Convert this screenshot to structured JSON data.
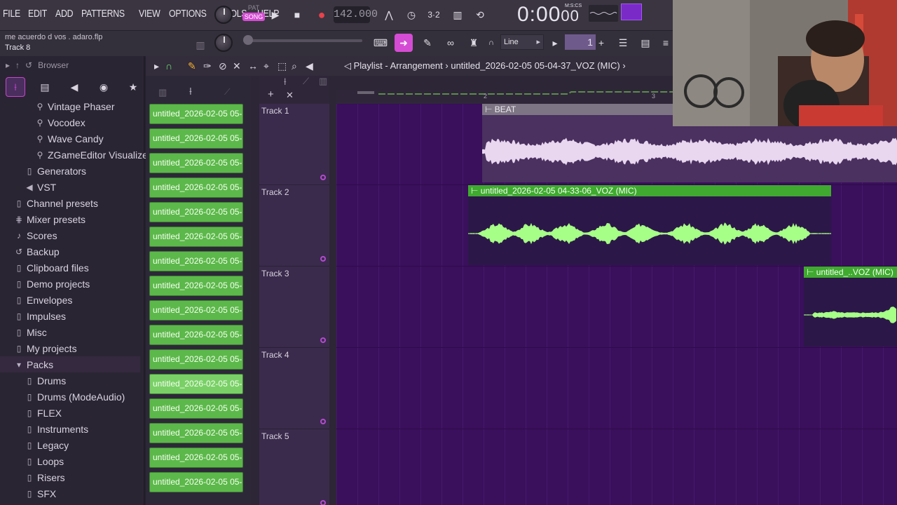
{
  "menu": [
    "FILE",
    "EDIT",
    "ADD",
    "PATTERNS",
    "VIEW",
    "OPTIONS",
    "TOOLS",
    "HELP"
  ],
  "transport": {
    "pat_label": "PAT",
    "song_label": "SONG",
    "tempo": "142.000",
    "time": "0:00",
    "time_small": "00",
    "time_format": "M:S:CS"
  },
  "project": {
    "filename": "me acuerdo d vos . adaro.flp",
    "hint": "Track 8"
  },
  "snap": "Line",
  "pattern_number": "1",
  "browser": {
    "title": "Browser",
    "items": [
      {
        "label": "Vintage Phaser",
        "icon": "plugin-icon",
        "indent": 2
      },
      {
        "label": "Vocodex",
        "icon": "plugin-icon",
        "indent": 2
      },
      {
        "label": "Wave Candy",
        "icon": "plugin-icon",
        "indent": 2
      },
      {
        "label": "ZGameEditor Visualizer",
        "icon": "plugin-icon",
        "indent": 2
      },
      {
        "label": "Generators",
        "icon": "folder-icon",
        "indent": 1
      },
      {
        "label": "VST",
        "icon": "speaker-icon",
        "indent": 1
      },
      {
        "label": "Channel presets",
        "icon": "folder-icon",
        "indent": 0
      },
      {
        "label": "Mixer presets",
        "icon": "mixer-icon",
        "indent": 0
      },
      {
        "label": "Scores",
        "icon": "note-icon",
        "indent": 0
      },
      {
        "label": "Backup",
        "icon": "backup-icon",
        "indent": 0
      },
      {
        "label": "Clipboard files",
        "icon": "folder-icon",
        "indent": 0
      },
      {
        "label": "Demo projects",
        "icon": "folder-icon",
        "indent": 0
      },
      {
        "label": "Envelopes",
        "icon": "folder-icon",
        "indent": 0
      },
      {
        "label": "Impulses",
        "icon": "folder-icon",
        "indent": 0
      },
      {
        "label": "Misc",
        "icon": "folder-icon",
        "indent": 0
      },
      {
        "label": "My projects",
        "icon": "folder-icon",
        "indent": 0
      },
      {
        "label": "Packs",
        "icon": "folder-open-icon",
        "indent": 0,
        "selected": true
      },
      {
        "label": "Drums",
        "icon": "folder-icon",
        "indent": 1
      },
      {
        "label": "Drums (ModeAudio)",
        "icon": "folder-icon",
        "indent": 1
      },
      {
        "label": "FLEX",
        "icon": "folder-icon",
        "indent": 1
      },
      {
        "label": "Instruments",
        "icon": "folder-icon",
        "indent": 1
      },
      {
        "label": "Legacy",
        "icon": "folder-icon",
        "indent": 1
      },
      {
        "label": "Loops",
        "icon": "folder-icon",
        "indent": 1
      },
      {
        "label": "Risers",
        "icon": "folder-icon",
        "indent": 1
      },
      {
        "label": "SFX",
        "icon": "folder-icon",
        "indent": 1
      }
    ]
  },
  "playlist": {
    "title": "Playlist - Arrangement",
    "path": "untitled_2026-02-05 05-04-37_VOZ (MIC)",
    "clip_picker": [
      "untitled_2026-02-05 05-...",
      "untitled_2026-02-05 05-...",
      "untitled_2026-02-05 05-...",
      "untitled_2026-02-05 05-...",
      "untitled_2026-02-05 05-...",
      "untitled_2026-02-05 05-...",
      "untitled_2026-02-05 05-...",
      "untitled_2026-02-05 05-...",
      "untitled_2026-02-05 05-...",
      "untitled_2026-02-05 05-...",
      "untitled_2026-02-05 05-...",
      "untitled_2026-02-05 05-...",
      "untitled_2026-02-05 05-...",
      "untitled_2026-02-05 05-...",
      "untitled_2026-02-05 05-...",
      "untitled_2026-02-05 05-..."
    ],
    "timeline_ticks": [
      "2",
      "3"
    ],
    "tracks": [
      "Track 1",
      "Track 2",
      "Track 3",
      "Track 4",
      "Track 5"
    ],
    "clips": [
      {
        "label": "BEAT",
        "kind": "beat"
      },
      {
        "label": "untitled_2026-02-05 04-33-06_VOZ (MIC)",
        "kind": "voz"
      },
      {
        "label": "untitled_..VOZ (MIC)",
        "kind": "voz"
      }
    ]
  },
  "colors": {
    "accent": "#d54cd4",
    "clip_green": "#5cb84a",
    "grid_bg": "#3a0f5c",
    "wave_beat": "#e9d6ef",
    "wave_voz": "#a6ff86"
  }
}
